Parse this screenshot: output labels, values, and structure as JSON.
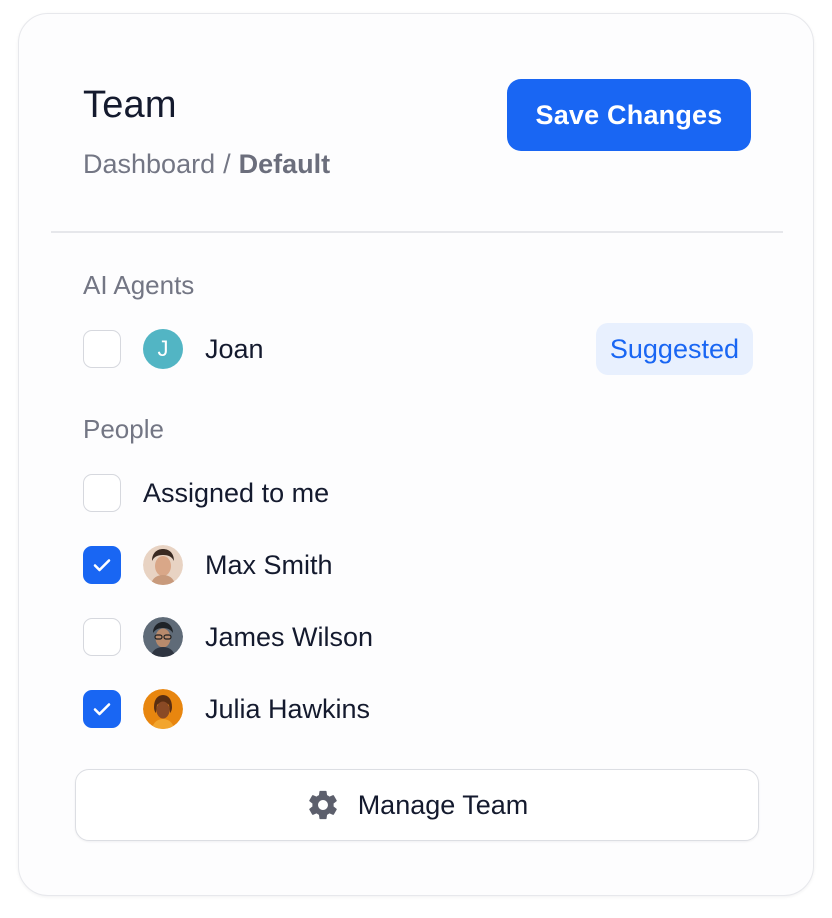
{
  "header": {
    "title": "Team",
    "breadcrumb": {
      "parent": "Dashboard",
      "separator": "/",
      "current": "Default"
    },
    "save_label": "Save Changes"
  },
  "sections": {
    "ai_agents": {
      "label": "AI Agents",
      "items": [
        {
          "name": "Joan",
          "initial": "J",
          "checked": false,
          "badge": "Suggested"
        }
      ]
    },
    "people": {
      "label": "People",
      "assigned": {
        "label": "Assigned to me",
        "checked": false
      },
      "items": [
        {
          "name": "Max Smith",
          "checked": true,
          "avatar": "photo-avatar"
        },
        {
          "name": "James Wilson",
          "checked": false,
          "avatar": "photo-avatar"
        },
        {
          "name": "Julia Hawkins",
          "checked": true,
          "avatar": "photo-avatar"
        }
      ]
    }
  },
  "footer": {
    "manage_label": "Manage Team",
    "manage_icon": "gear-icon"
  },
  "colors": {
    "accent": "#1966f3",
    "badge_bg": "#e8f0fe",
    "agent_avatar": "#52b5c4",
    "text_primary": "#141a2e",
    "text_muted": "#737684"
  }
}
